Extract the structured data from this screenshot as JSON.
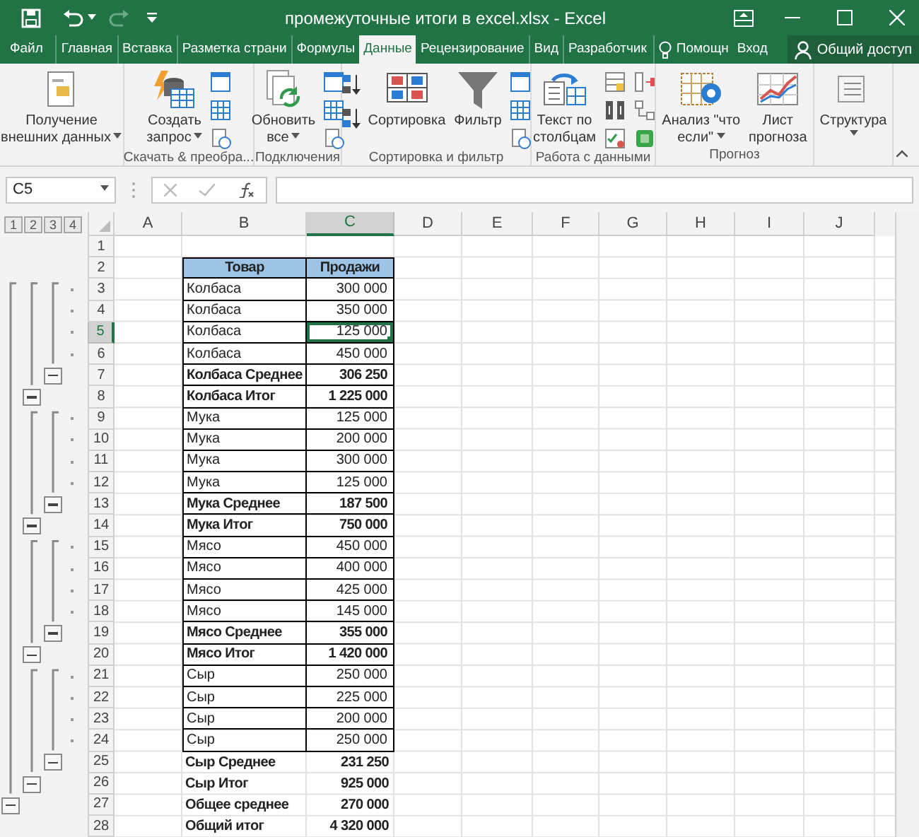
{
  "title_bar": {
    "title": "промежуточные итоги в excel.xlsx - Excel"
  },
  "tabs": [
    {
      "label": "Файл",
      "selected": false
    },
    {
      "label": "Главная",
      "selected": false
    },
    {
      "label": "Вставка",
      "selected": false
    },
    {
      "label": "Разметка страни",
      "selected": false
    },
    {
      "label": "Формулы",
      "selected": false
    },
    {
      "label": "Данные",
      "selected": true
    },
    {
      "label": "Рецензирование",
      "selected": false
    },
    {
      "label": "Вид",
      "selected": false
    },
    {
      "label": "Разработчик",
      "selected": false
    }
  ],
  "tell_me": "Помощн",
  "sign_in": "Вход",
  "share": "Общий доступ",
  "ribbon_groups": [
    {
      "items": [
        {
          "kind": "getdata",
          "lines": [
            "Получение",
            "внешних данных"
          ],
          "dropdown": true
        }
      ]
    },
    {
      "label": "Скачать & преобра...",
      "items": [
        {
          "kind": "newquery",
          "lines": [
            "Создать",
            "запрос"
          ],
          "dropdown": true
        },
        {
          "kind": "smallstack"
        }
      ]
    },
    {
      "label": "Подключения",
      "items": [
        {
          "kind": "refresh",
          "lines": [
            "Обновить",
            "все"
          ],
          "dropdown": true
        },
        {
          "kind": "smallstack"
        }
      ]
    },
    {
      "label": "Сортировка и фильтр",
      "items": [
        {
          "kind": "sortpair"
        },
        {
          "kind": "sort",
          "lines": [
            "Сортировка"
          ],
          "dropdown": false
        },
        {
          "kind": "filter",
          "lines": [
            "Фильтр"
          ],
          "dropdown": false
        },
        {
          "kind": "smallstack"
        }
      ]
    },
    {
      "label": "Работа с данными",
      "items": [
        {
          "kind": "texttocolumns",
          "lines": [
            "Текст по",
            "столбцам"
          ],
          "dropdown": false
        },
        {
          "kind": "smallgrid"
        }
      ]
    },
    {
      "label": "Прогноз",
      "items": [
        {
          "kind": "whatif",
          "lines": [
            "Анализ \"что",
            "если\""
          ],
          "dropdown": true
        },
        {
          "kind": "forecast",
          "lines": [
            "Лист",
            "прогноза"
          ],
          "dropdown": false
        }
      ]
    },
    {
      "items": [
        {
          "kind": "outline",
          "lines": [
            "Структура"
          ],
          "dropdown": true
        }
      ]
    }
  ],
  "name_box": "C5",
  "outline_levels": [
    "1",
    "2",
    "3",
    "4"
  ],
  "columns": [
    {
      "label": "A",
      "selected": false
    },
    {
      "label": "B",
      "selected": false
    },
    {
      "label": "C",
      "selected": true
    },
    {
      "label": "D",
      "selected": false
    },
    {
      "label": "E",
      "selected": false
    },
    {
      "label": "F",
      "selected": false
    },
    {
      "label": "G",
      "selected": false
    },
    {
      "label": "H",
      "selected": false
    },
    {
      "label": "I",
      "selected": false
    },
    {
      "label": "J",
      "selected": false
    }
  ],
  "rows": [
    {
      "number": "1",
      "kind": "blank",
      "selected": false,
      "bordered": false
    },
    {
      "number": "2",
      "kind": "header",
      "selected": false,
      "bordered": true,
      "product": "Товар",
      "sales": "Продажи"
    },
    {
      "number": "3",
      "kind": "detail",
      "selected": false,
      "bordered": true,
      "product": "Колбаса",
      "sales": "300 000"
    },
    {
      "number": "4",
      "kind": "detail",
      "selected": false,
      "bordered": true,
      "product": "Колбаса",
      "sales": "350 000"
    },
    {
      "number": "5",
      "kind": "detail",
      "selected": true,
      "bordered": true,
      "product": "Колбаса",
      "sales": "125 000"
    },
    {
      "number": "6",
      "kind": "detail",
      "selected": false,
      "bordered": true,
      "product": "Колбаса",
      "sales": "450 000"
    },
    {
      "number": "7",
      "kind": "average",
      "selected": false,
      "bordered": true,
      "expanded": true,
      "product": "Колбаса Среднее",
      "sales": "306 250"
    },
    {
      "number": "8",
      "kind": "total",
      "selected": false,
      "bordered": true,
      "expanded": true,
      "product": "Колбаса Итог",
      "sales": "1 225 000"
    },
    {
      "number": "9",
      "kind": "detail",
      "selected": false,
      "bordered": true,
      "product": "Мука",
      "sales": "125 000"
    },
    {
      "number": "10",
      "kind": "detail",
      "selected": false,
      "bordered": true,
      "product": "Мука",
      "sales": "200 000"
    },
    {
      "number": "11",
      "kind": "detail",
      "selected": false,
      "bordered": true,
      "product": "Мука",
      "sales": "300 000"
    },
    {
      "number": "12",
      "kind": "detail",
      "selected": false,
      "bordered": true,
      "product": "Мука",
      "sales": "125 000"
    },
    {
      "number": "13",
      "kind": "average",
      "selected": false,
      "bordered": true,
      "expanded": true,
      "product": "Мука Среднее",
      "sales": "187 500"
    },
    {
      "number": "14",
      "kind": "total",
      "selected": false,
      "bordered": true,
      "expanded": true,
      "product": "Мука Итог",
      "sales": "750 000"
    },
    {
      "number": "15",
      "kind": "detail",
      "selected": false,
      "bordered": true,
      "product": "Мясо",
      "sales": "450 000"
    },
    {
      "number": "16",
      "kind": "detail",
      "selected": false,
      "bordered": true,
      "product": "Мясо",
      "sales": "400 000"
    },
    {
      "number": "17",
      "kind": "detail",
      "selected": false,
      "bordered": true,
      "product": "Мясо",
      "sales": "425 000"
    },
    {
      "number": "18",
      "kind": "detail",
      "selected": false,
      "bordered": true,
      "product": "Мясо",
      "sales": "145 000"
    },
    {
      "number": "19",
      "kind": "average",
      "selected": false,
      "bordered": true,
      "expanded": true,
      "product": "Мясо Среднее",
      "sales": "355 000"
    },
    {
      "number": "20",
      "kind": "total",
      "selected": false,
      "bordered": true,
      "expanded": true,
      "product": "Мясо Итог",
      "sales": "1 420 000"
    },
    {
      "number": "21",
      "kind": "detail",
      "selected": false,
      "bordered": true,
      "product": "Сыр",
      "sales": "250 000"
    },
    {
      "number": "22",
      "kind": "detail",
      "selected": false,
      "bordered": true,
      "product": "Сыр",
      "sales": "225 000"
    },
    {
      "number": "23",
      "kind": "detail",
      "selected": false,
      "bordered": true,
      "product": "Сыр",
      "sales": "200 000"
    },
    {
      "number": "24",
      "kind": "detail",
      "selected": false,
      "bordered": true,
      "product": "Сыр",
      "sales": "250 000"
    },
    {
      "number": "25",
      "kind": "average",
      "selected": false,
      "bordered": false,
      "expanded": true,
      "product": "Сыр Среднее",
      "sales": "231 250"
    },
    {
      "number": "26",
      "kind": "total",
      "selected": false,
      "bordered": false,
      "expanded": true,
      "product": "Сыр Итог",
      "sales": "925 000"
    },
    {
      "number": "27",
      "kind": "overall_average",
      "selected": false,
      "bordered": false,
      "expanded": true,
      "product": "Общее среднее",
      "sales": "270 000"
    },
    {
      "number": "28",
      "kind": "grand_total",
      "selected": false,
      "bordered": false,
      "product": "Общий итог",
      "sales": "4 320 000"
    }
  ]
}
